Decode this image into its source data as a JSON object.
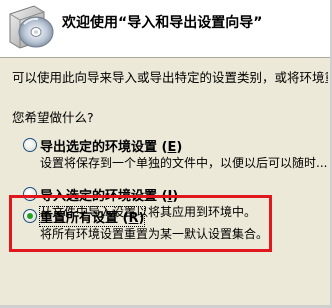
{
  "header": {
    "title": "欢迎使用“导入和导出设置向导”"
  },
  "intro_text": "可以使用此向导来导入或导出特定的设置类别，或将环境重",
  "question": "您希望做什么?",
  "options": [
    {
      "label": "导出选定的环境设置",
      "hotkey": "E",
      "description": "设置将保存到一个单独的文件中，以便以后可以随时...",
      "selected": false
    },
    {
      "label": "导入选定的环境设置",
      "hotkey": "I",
      "description": "从文件中导入设置以将其应用到环境中。",
      "selected": false
    },
    {
      "label": "重置所有设置",
      "hotkey": "R",
      "description": "将所有环境设置重置为某一默认设置集合。",
      "selected": true
    }
  ],
  "colors": {
    "highlight": "#e0171d",
    "radio_dot": "#21a121"
  },
  "icons": {
    "wizard": "cd-disc-wizard-icon"
  }
}
